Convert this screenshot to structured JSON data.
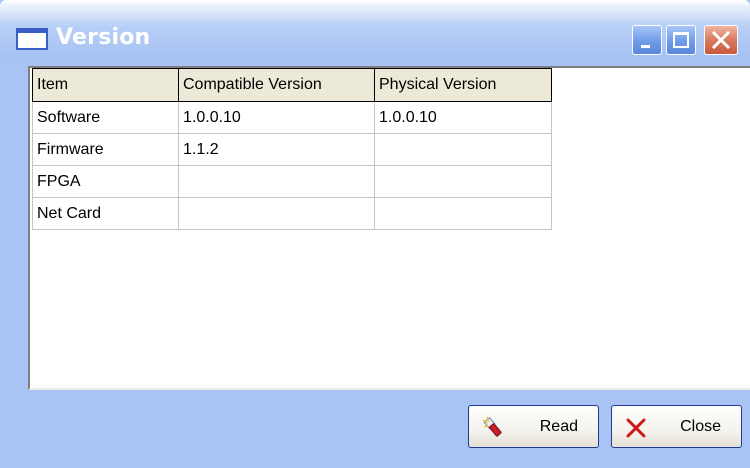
{
  "window": {
    "title": "Version"
  },
  "titlebar_buttons": {
    "minimize": "minimize-icon",
    "maximize": "maximize-icon",
    "close": "close-icon"
  },
  "table": {
    "columns": [
      "Item",
      "Compatible Version",
      "Physical Version"
    ],
    "rows": [
      [
        "Software",
        "1.0.0.10",
        "1.0.0.10"
      ],
      [
        "Firmware",
        "1.1.2",
        ""
      ],
      [
        "FPGA",
        "",
        ""
      ],
      [
        "Net Card",
        "",
        ""
      ]
    ]
  },
  "buttons": {
    "read_label": "Read",
    "read_icon": "flashlight-icon",
    "close_label": "Close",
    "close_icon": "x-icon"
  },
  "colors": {
    "window_frame": "#a9c4f4",
    "titlebar_text": "#ffffff",
    "close_button": "#c8583b",
    "header_bg": "#ece9d8"
  }
}
